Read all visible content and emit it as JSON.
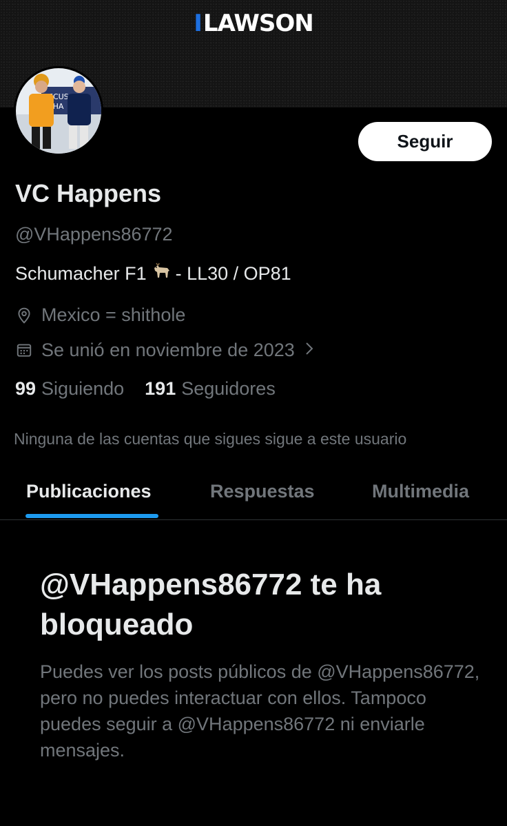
{
  "banner": {
    "brand": "LAWSON",
    "brand_color": "#1d6fe0"
  },
  "profile": {
    "name": "VC Happens",
    "handle": "@VHappens86772",
    "bio_prefix": "Schumacher F1",
    "bio_emoji": "goat-emoji",
    "bio_suffix": "- LL30 / OP81",
    "location": "Mexico = shithole",
    "joined": "Se unió en noviembre de 2023",
    "following_count": "99",
    "following_label": "Siguiendo",
    "followers_count": "191",
    "followers_label": "Seguidores",
    "mutual_note": "Ninguna de las cuentas que sigues sigue a este usuario"
  },
  "actions": {
    "follow_label": "Seguir"
  },
  "tabs": [
    {
      "label": "Publicaciones",
      "active": true
    },
    {
      "label": "Respuestas",
      "active": false
    },
    {
      "label": "Multimedia",
      "active": false
    }
  ],
  "blocked": {
    "title": "@VHappens86772 te ha bloqueado",
    "description": "Puedes ver los posts públicos de @VHappens86772, pero no puedes interactuar con ellos. Tampoco puedes seguir a @VHappens86772 ni enviarle mensajes."
  },
  "icons": {
    "location": "location-pin-icon",
    "calendar": "calendar-icon",
    "chevron": "chevron-right-icon"
  },
  "colors": {
    "background": "#000000",
    "primary_text": "#e7e9ea",
    "secondary_text": "#71767b",
    "accent": "#1d9bf0"
  }
}
